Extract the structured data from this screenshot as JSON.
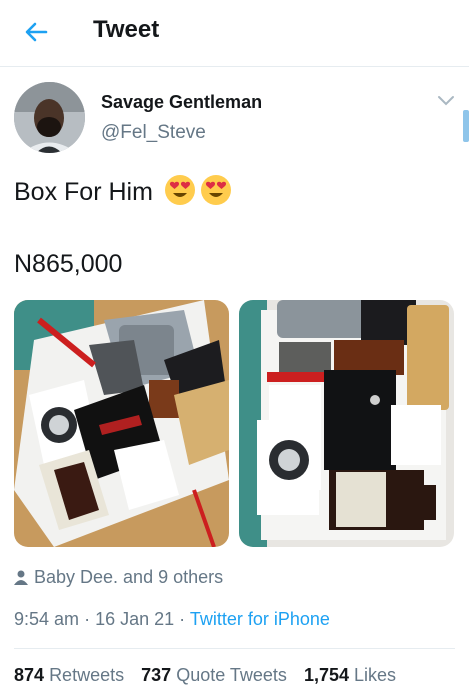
{
  "header": {
    "title": "Tweet",
    "back_icon": "arrow-left-icon",
    "accent": "#1da1f2"
  },
  "tweet": {
    "author_name": "Savage Gentleman",
    "author_handle": "@Fel_Steve",
    "text_line1": "Box For Him",
    "text_emojis": [
      "heart-eyes-emoji",
      "heart-eyes-emoji"
    ],
    "text_line2": "N865,000",
    "liked_by": "Baby Dee. and 9 others",
    "time": "9:54 am",
    "date": "16 Jan 21",
    "sep": "·",
    "source": "Twitter for iPhone",
    "stats": [
      {
        "count": "874",
        "label": "Retweets"
      },
      {
        "count": "737",
        "label": "Quote Tweets"
      },
      {
        "count": "1,754",
        "label": "Likes"
      }
    ]
  }
}
